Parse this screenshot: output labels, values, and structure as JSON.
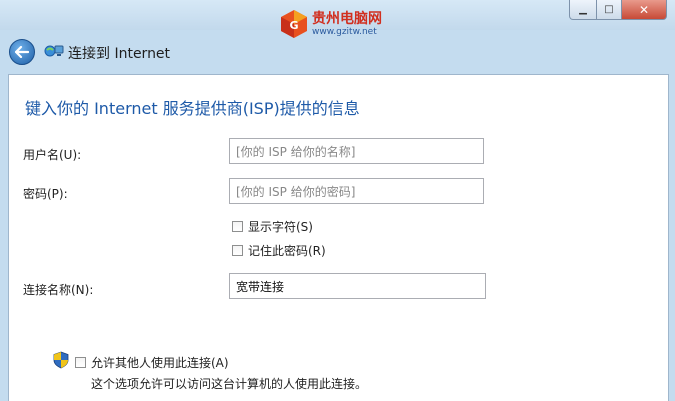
{
  "titlebar": {
    "min_glyph": "▁",
    "max_glyph": "□",
    "close_glyph": "✕"
  },
  "watermark": {
    "title": "贵州电脑网",
    "url": "www.gzitw.net"
  },
  "nav": {
    "title": "连接到 Internet"
  },
  "form": {
    "heading": "键入你的 Internet 服务提供商(ISP)提供的信息",
    "username_label": "用户名(U):",
    "username_placeholder": "[你的 ISP 给你的名称]",
    "password_label": "密码(P):",
    "password_placeholder": "[你的 ISP 给你的密码]",
    "show_chars_label": "显示字符(S)",
    "remember_label": "记住此密码(R)",
    "conn_name_label": "连接名称(N):",
    "conn_name_value": "宽带连接",
    "allow_others_label": "允许其他人使用此连接(A)",
    "allow_others_desc": "这个选项允许可以访问这台计算机的人使用此连接。"
  }
}
